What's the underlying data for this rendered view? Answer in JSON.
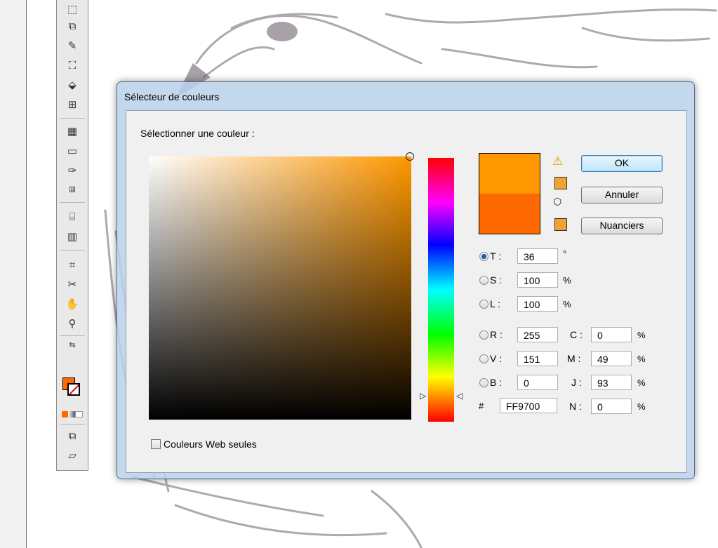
{
  "dialog": {
    "title": "Sélecteur de couleurs",
    "select_label": "Sélectionner une couleur :",
    "buttons": {
      "ok": "OK",
      "cancel": "Annuler",
      "swatches": "Nuanciers"
    },
    "hsb": [
      {
        "label": "T :",
        "value": "36",
        "unit": "°",
        "selected": true
      },
      {
        "label": "S :",
        "value": "100",
        "unit": "%",
        "selected": false
      },
      {
        "label": "L :",
        "value": "100",
        "unit": "%",
        "selected": false
      }
    ],
    "rgb": [
      {
        "label": "R :",
        "value": "255"
      },
      {
        "label": "V :",
        "value": "151"
      },
      {
        "label": "B :",
        "value": "0"
      }
    ],
    "cmjn": [
      {
        "label": "C :",
        "value": "0",
        "unit": "%"
      },
      {
        "label": "M :",
        "value": "49",
        "unit": "%"
      },
      {
        "label": "J :",
        "value": "93",
        "unit": "%"
      },
      {
        "label": "N :",
        "value": "0",
        "unit": "%"
      }
    ],
    "hex": {
      "sign": "#",
      "value": "FF9700"
    },
    "web_only_label": "Couleurs Web seules",
    "web_only_checked": false,
    "colors": {
      "new": "#ff9700",
      "original": "#ff6a00",
      "web_safe_warning": "#f2a230"
    }
  },
  "toolbar": {
    "fill_color": "#ff6a00",
    "stroke": "none"
  }
}
